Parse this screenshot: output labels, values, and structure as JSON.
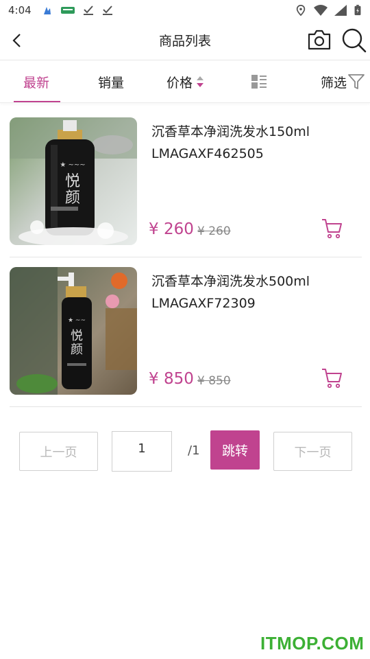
{
  "status_bar": {
    "time": "4:04"
  },
  "header": {
    "title": "商品列表"
  },
  "tabs": [
    {
      "label": "最新"
    },
    {
      "label": "销量"
    },
    {
      "label": "价格"
    },
    {
      "label": "筛选"
    }
  ],
  "products": [
    {
      "name": "沉香草本净润洗发水150ml",
      "code": "LMAGAXF462505",
      "price": "¥ 260",
      "original_price": "¥ 260"
    },
    {
      "name": "沉香草本净润洗发水500ml",
      "code": "LMAGAXF72309",
      "price": "¥ 850",
      "original_price": "¥ 850"
    }
  ],
  "pagination": {
    "prev_label": "上一页",
    "current_page": "1",
    "total_pages": "/1",
    "jump_label": "跳转",
    "next_label": "下一页"
  },
  "watermark": "ITMOP.COM",
  "colors": {
    "accent": "#c0438f",
    "watermark": "#3cb034"
  }
}
